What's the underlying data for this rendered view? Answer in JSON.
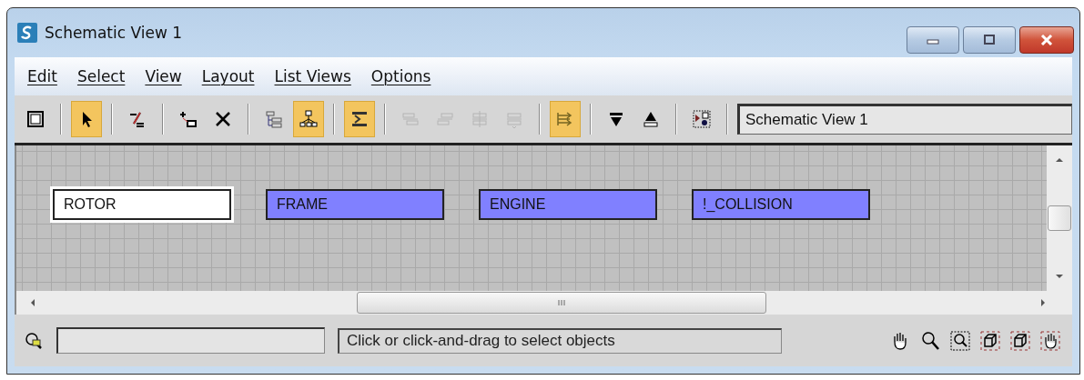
{
  "window": {
    "title": "Schematic View 1"
  },
  "menu": [
    {
      "label": "Edit"
    },
    {
      "label": "Select"
    },
    {
      "label": "View"
    },
    {
      "label": "Layout"
    },
    {
      "label": "List Views"
    },
    {
      "label": "Options"
    }
  ],
  "toolbar": [
    {
      "kind": "button",
      "active": false,
      "disabled": false
    },
    {
      "kind": "separator"
    },
    {
      "kind": "button",
      "active": true,
      "disabled": false
    },
    {
      "kind": "separator"
    },
    {
      "kind": "button",
      "active": false,
      "disabled": false
    },
    {
      "kind": "separator"
    },
    {
      "kind": "button",
      "active": false,
      "disabled": false
    },
    {
      "kind": "button",
      "active": false,
      "disabled": false
    },
    {
      "kind": "separator"
    },
    {
      "kind": "button",
      "active": false,
      "disabled": false
    },
    {
      "kind": "button",
      "active": true,
      "disabled": false
    },
    {
      "kind": "separator"
    },
    {
      "kind": "button",
      "active": true,
      "disabled": false
    },
    {
      "kind": "separator"
    },
    {
      "kind": "button",
      "active": false,
      "disabled": true
    },
    {
      "kind": "button",
      "active": false,
      "disabled": true
    },
    {
      "kind": "button",
      "active": false,
      "disabled": true
    },
    {
      "kind": "button",
      "active": false,
      "disabled": true
    },
    {
      "kind": "separator"
    },
    {
      "kind": "button",
      "active": true,
      "disabled": false
    },
    {
      "kind": "separator"
    },
    {
      "kind": "button",
      "active": false,
      "disabled": false
    },
    {
      "kind": "button",
      "active": false,
      "disabled": false
    },
    {
      "kind": "separator"
    },
    {
      "kind": "button",
      "active": false,
      "disabled": false
    },
    {
      "kind": "separator"
    }
  ],
  "view_name_field": {
    "value": "Schematic View 1"
  },
  "nodes": [
    {
      "label": "ROTOR",
      "selected": true
    },
    {
      "label": "FRAME",
      "selected": false
    },
    {
      "label": "ENGINE",
      "selected": false
    },
    {
      "label": "!_COLLISION",
      "selected": false
    }
  ],
  "status_bar": {
    "prompt": "Click or click-and-drag to select objects"
  }
}
